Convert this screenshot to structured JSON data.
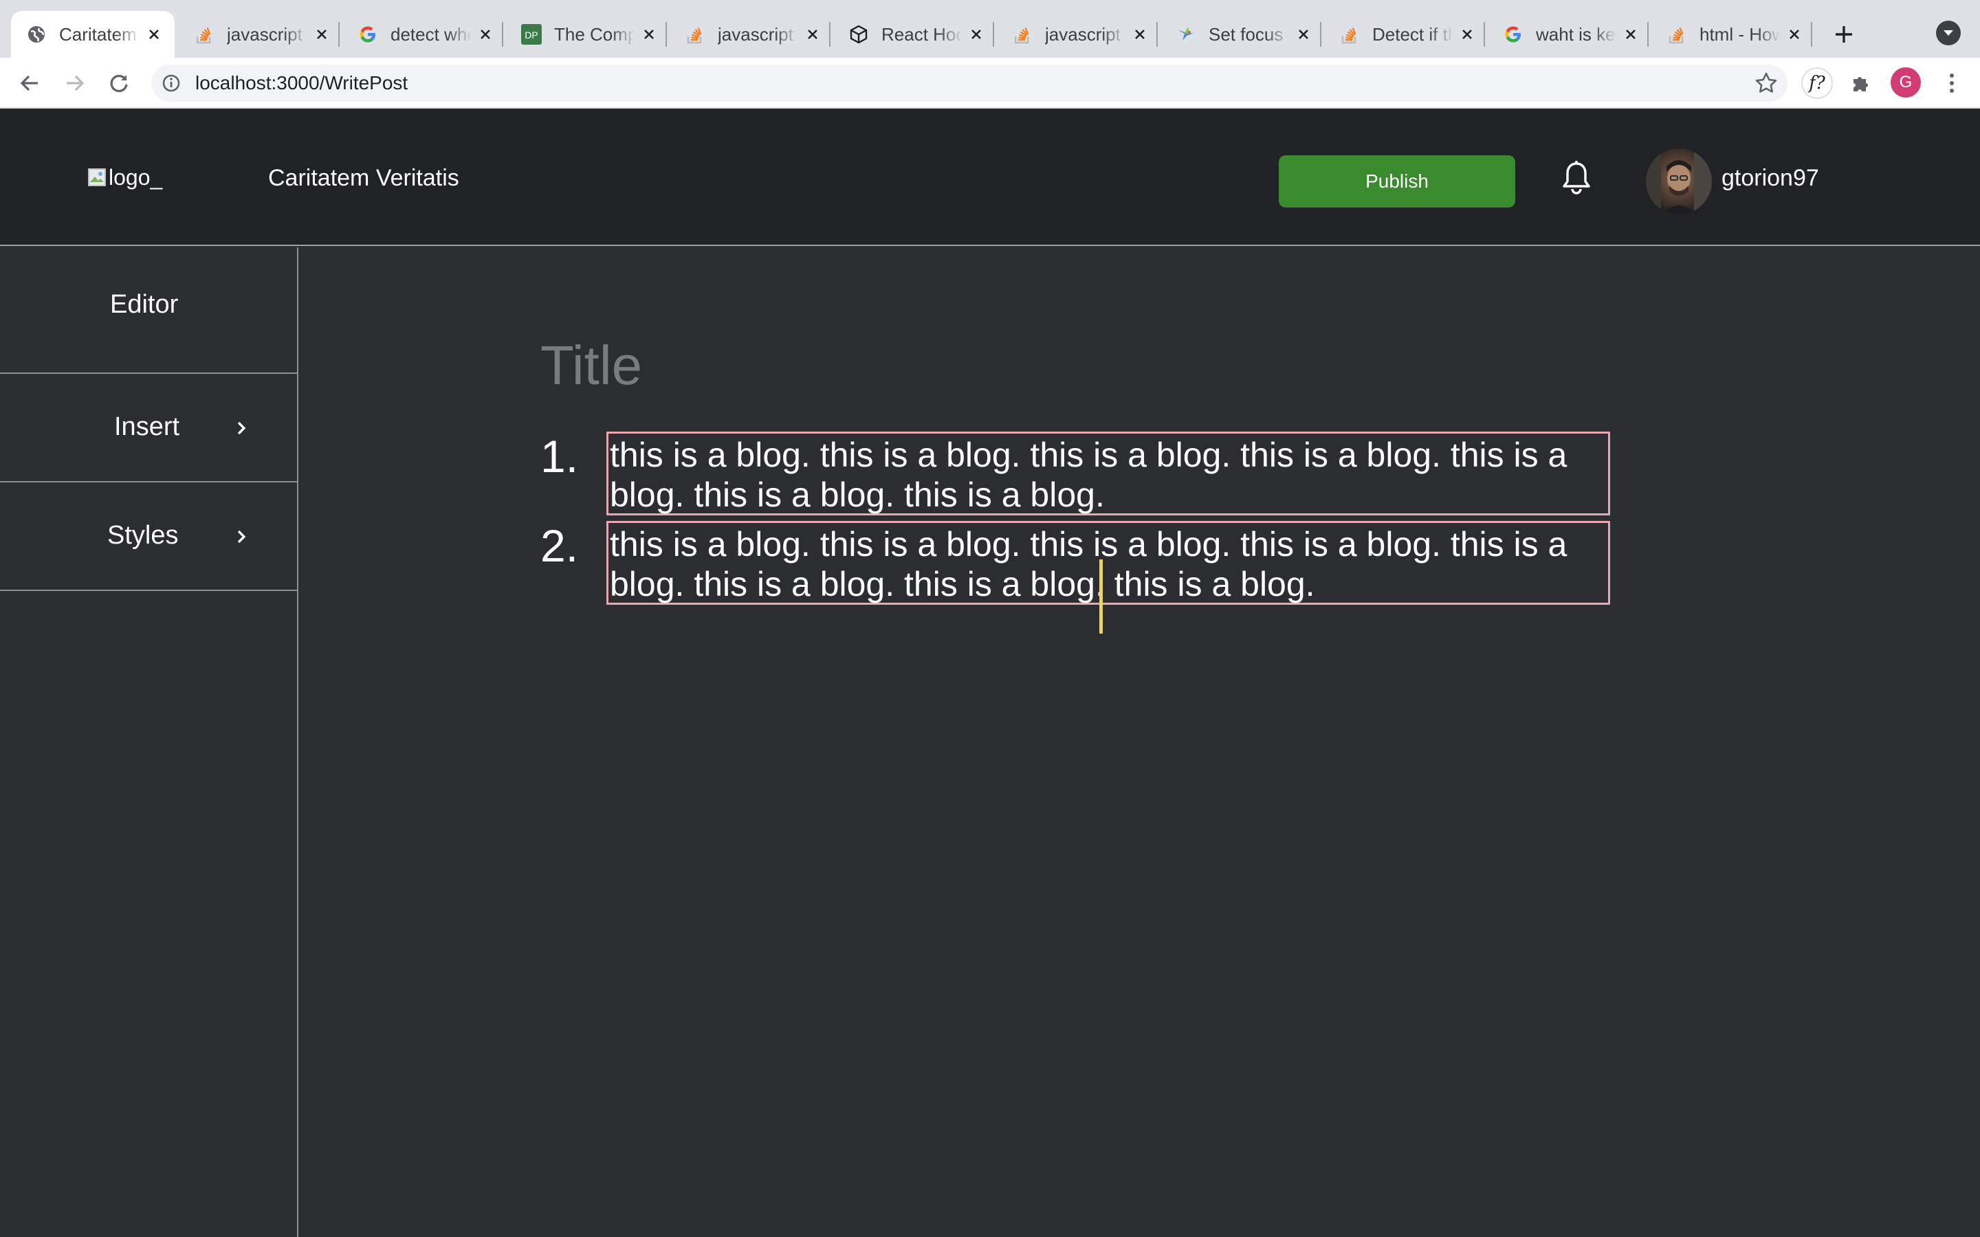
{
  "browser": {
    "tabs": [
      {
        "title": "Caritatem Veritatis",
        "icon": "globe-icon",
        "active": true
      },
      {
        "title": "javascript - Stack Overflow",
        "icon": "stackoverflow-icon"
      },
      {
        "title": "detect when - Google Search",
        "icon": "google-icon"
      },
      {
        "title": "The Complete Guide",
        "icon": "dp-icon"
      },
      {
        "title": "javascript - Stack Overflow",
        "icon": "stackoverflow-icon"
      },
      {
        "title": "React Hooks",
        "icon": "codesandbox-icon"
      },
      {
        "title": "javascript - Stack Overflow",
        "icon": "stackoverflow-icon"
      },
      {
        "title": "Set focus",
        "icon": "hummingbird-icon"
      },
      {
        "title": "Detect if the",
        "icon": "stackoverflow-icon"
      },
      {
        "title": "waht is keyup - Google Search",
        "icon": "google-icon"
      },
      {
        "title": "html - How to",
        "icon": "stackoverflow-icon"
      }
    ],
    "url": "localhost:3000/WritePost",
    "profile_initial": "G",
    "extension_label": "f?"
  },
  "header": {
    "logo_alt": "logo_",
    "site_name": "Caritatem Veritatis",
    "publish_label": "Publish",
    "username": "gtorion97"
  },
  "sidebar": {
    "items": [
      {
        "label": "Editor"
      },
      {
        "label": "Insert"
      },
      {
        "label": "Styles"
      }
    ]
  },
  "editor": {
    "title_placeholder": "Title",
    "blocks": [
      {
        "number": "1.",
        "text": "this is a blog. this is a blog. this is a blog. this is a blog. this is a blog. this is a blog. this is a blog."
      },
      {
        "number": "2.",
        "text": "this is a blog. this is a blog. this is a blog. this is a blog. this is a blog. this is a blog. this is a blog. this is a blog."
      }
    ]
  },
  "colors": {
    "header_bg": "#212226",
    "page_bg": "#2c2d30",
    "publish_green": "#3a8a2e",
    "block_border": "#e9a7b1",
    "caret": "#f3d548"
  }
}
